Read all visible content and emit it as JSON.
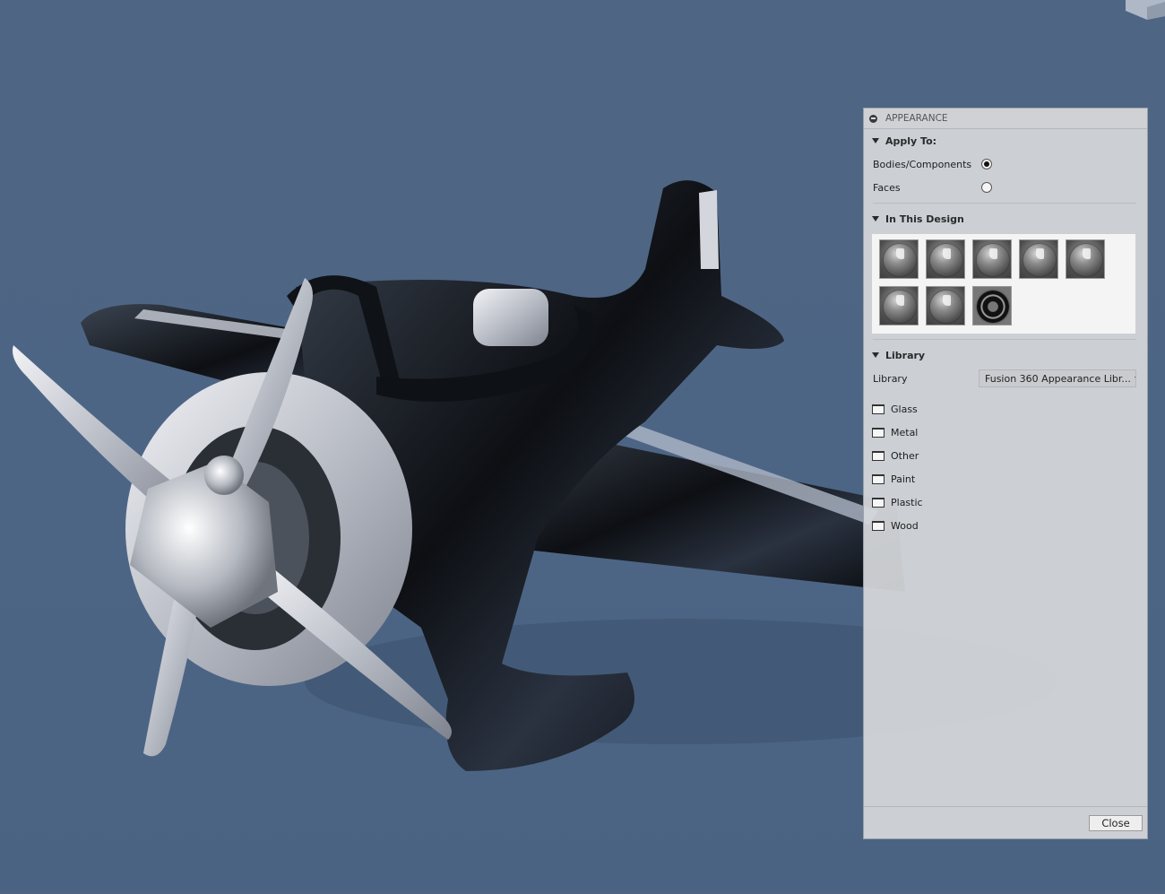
{
  "panel": {
    "title": "APPEARANCE",
    "apply_to": {
      "heading": "Apply To:",
      "options": [
        {
          "label": "Bodies/Components",
          "selected": true
        },
        {
          "label": "Faces",
          "selected": false
        }
      ]
    },
    "in_this_design": {
      "heading": "In This Design",
      "swatches": [
        "chrome-swatch",
        "chrome-swatch",
        "chrome-swatch",
        "chrome-swatch",
        "chrome-swatch",
        "chrome-swatch",
        "chrome-swatch",
        "black-tire-swatch"
      ]
    },
    "library": {
      "heading": "Library",
      "label": "Library",
      "selected": "Fusion 360 Appearance Libr...",
      "folders": [
        "Glass",
        "Metal",
        "Other",
        "Paint",
        "Plastic",
        "Wood"
      ]
    },
    "close_label": "Close"
  },
  "colors": {
    "viewport_background": "#4e6584",
    "panel_background": "#d6d8db"
  }
}
